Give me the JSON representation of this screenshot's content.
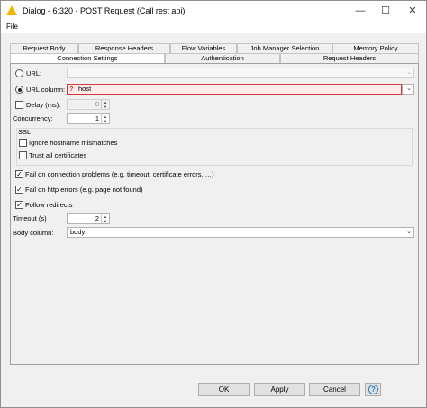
{
  "window": {
    "title": "Dialog - 6:320 - POST Request (Call rest api)",
    "minimize": "—",
    "maximize": "☐",
    "close": "✕"
  },
  "menu": {
    "file": "File"
  },
  "tabs_row1": [
    "Request Body",
    "Response Headers",
    "Flow Variables",
    "Job Manager Selection",
    "Memory Policy"
  ],
  "tabs_row2": [
    "Connection Settings",
    "Authentication",
    "Request Headers"
  ],
  "active_tab": "Connection Settings",
  "connection": {
    "url_label": "URL:",
    "url_value": "",
    "url_column_label": "URL column:",
    "url_column_value": "host",
    "url_column_warning": "?",
    "delay_label": "Delay (ms):",
    "delay_value": "0",
    "concurrency_label": "Concurrency:",
    "concurrency_value": "1",
    "ssl_title": "SSL",
    "ignore_hostname_label": "Ignore hostname mismatches",
    "trust_certs_label": "Trust all certificates",
    "fail_connection_label": "Fail on connection problems (e.g. timeout, certificate errors, …)",
    "fail_http_label": "Fail on http errors (e.g. page not found)",
    "follow_redirects_label": "Follow redirects",
    "timeout_label": "Timeout (s)",
    "timeout_value": "2",
    "body_column_label": "Body column:",
    "body_column_value": "body"
  },
  "state": {
    "url_selected": false,
    "url_column_selected": true,
    "delay_checked": false,
    "ignore_hostname_checked": false,
    "trust_certs_checked": false,
    "fail_connection_checked": true,
    "fail_http_checked": true,
    "follow_redirects_checked": true
  },
  "buttons": {
    "ok": "OK",
    "apply": "Apply",
    "cancel": "Cancel",
    "help": "?"
  },
  "icons": {
    "title": "warning-triangle-icon",
    "dropdown": "chevron-down-icon",
    "spinner": "spinner-arrows-icon",
    "help": "help-icon"
  },
  "colors": {
    "error_border": "#d23b3b",
    "error_fill": "#fdeaea",
    "warning_icon": "#f2b600",
    "help_icon": "#2a7ab8"
  }
}
